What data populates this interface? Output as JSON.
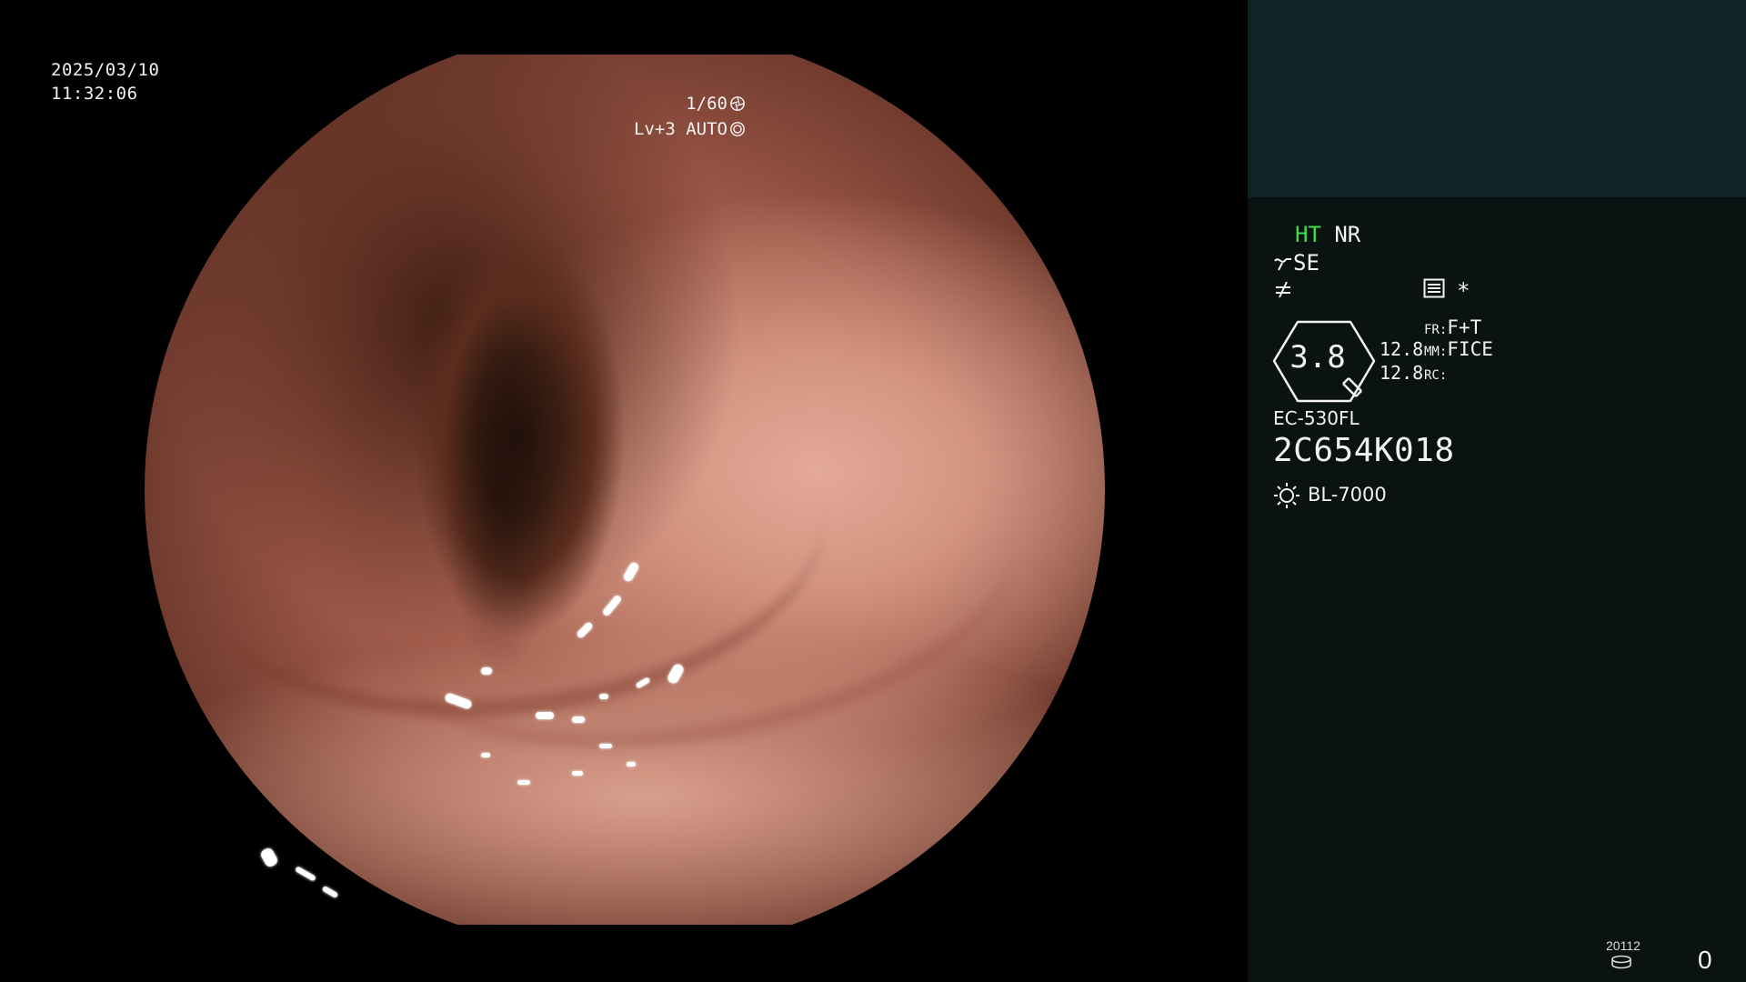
{
  "overlay": {
    "date": "2025/03/10",
    "time": "11:32:06",
    "shutter": "1/60",
    "shutter_icon": "aperture-icon",
    "iris_level": "Lv+3 AUTO",
    "iris_icon": "iris-auto-icon"
  },
  "panel": {
    "enhance_ht": "HT",
    "enhance_nr": "NR",
    "structure_mode": "SE",
    "structure_icon": "structure-enhance-icon",
    "color_icon": "color-tone-icon",
    "settings_icon": "settings-list-icon",
    "star": "*",
    "zoom": "3.8",
    "value_1": "12.8",
    "value_2": "12.8",
    "fr_label": "FR:",
    "fr_value": "F+T",
    "mm_label": "MM:",
    "mm_value": "FICE",
    "rc_label": "RC:",
    "rc_value": "",
    "scope_model": "EC-530FL",
    "scope_serial": "2C654K018",
    "light_source": "BL-7000",
    "light_icon": "light-source-icon",
    "counter_label": "20112",
    "counter_value": "0"
  },
  "colors": {
    "panel_bg": "#0a1212",
    "panel_top_bg": "#0f2424",
    "ht_green": "#3ee04a",
    "text": "#f2f2f2"
  }
}
